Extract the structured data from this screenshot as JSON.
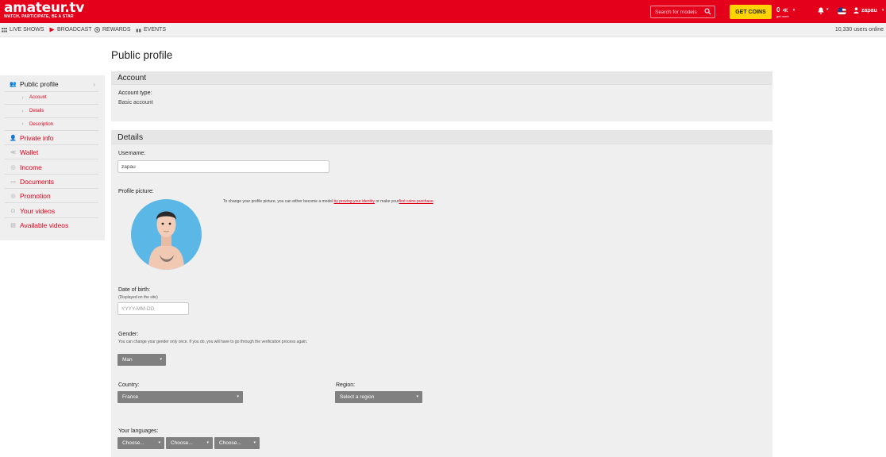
{
  "header": {
    "logo": "amateur.tv",
    "logo_tagline": "WATCH, PARTICIPATE, BE A STAR",
    "search_placeholder": "Search for models",
    "get_coins_label": "GET COINS",
    "coin_count": "0",
    "coin_sub": "get more",
    "username": "zapau"
  },
  "nav": {
    "items": [
      {
        "label": "LIVE SHOWS",
        "icon": "grid-icon"
      },
      {
        "label": "BROADCAST",
        "icon": "play-icon"
      },
      {
        "label": "REWARDS",
        "icon": "reward-icon"
      },
      {
        "label": "EVENTS",
        "icon": "gift-icon"
      }
    ],
    "online_text": "10,330 users online"
  },
  "page_title": "Public profile",
  "sidebar": {
    "items": [
      {
        "label": "Public profile",
        "icon": "profile-icon",
        "sub": false
      },
      {
        "label": "Account",
        "icon": "chevron-right-icon",
        "sub": true
      },
      {
        "label": "Details",
        "icon": "chevron-right-icon",
        "sub": true
      },
      {
        "label": "Description",
        "icon": "chevron-right-icon",
        "sub": true
      },
      {
        "label": "Private info",
        "icon": "user-icon",
        "sub": false
      },
      {
        "label": "Wallet",
        "icon": "wallet-icon",
        "sub": false
      },
      {
        "label": "Income",
        "icon": "coin-icon",
        "sub": false
      },
      {
        "label": "Documents",
        "icon": "document-icon",
        "sub": false
      },
      {
        "label": "Promotion",
        "icon": "promotion-icon",
        "sub": false
      },
      {
        "label": "Your videos",
        "icon": "video-icon",
        "sub": false
      },
      {
        "label": "Available videos",
        "icon": "film-icon",
        "sub": false
      }
    ]
  },
  "account": {
    "heading": "Account",
    "type_label": "Account type:",
    "type_value": "Basic account"
  },
  "details": {
    "heading": "Details",
    "username_label": "Username:",
    "username_value": "zapau",
    "picture_label": "Profile picture:",
    "picture_note_prefix": "To change your profile picture, you can either become a model ",
    "picture_note_link1": "by proving your identity",
    "picture_note_middle": " or make your",
    "picture_note_link2": "first coins purchase",
    "picture_note_suffix": ".",
    "dob_label": "Date of birth:",
    "dob_sub": "(Displayed on the site)",
    "dob_placeholder": "YYYY-MM-DD",
    "gender_label": "Gender:",
    "gender_sub": "You can change your gender only once. If you do, you will have to go through the verification process again.",
    "gender_value": "Man",
    "country_label": "Country:",
    "country_value": "France",
    "region_label": "Region:",
    "region_value": "Select a region",
    "languages_label": "Your languages:",
    "language_options": [
      "Choose...",
      "Choose...",
      "Choose..."
    ]
  },
  "colors": {
    "brand": "#e4001b",
    "coins": "#ffd400",
    "dropdown": "#808080"
  }
}
